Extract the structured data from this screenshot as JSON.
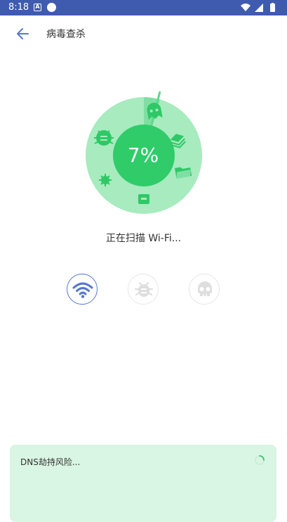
{
  "status_bar": {
    "time": "8:18",
    "icons": [
      "accessibility-icon",
      "circle-notification-icon",
      "wifi-icon",
      "signal-icon",
      "battery-icon"
    ]
  },
  "header": {
    "title": "病毒查杀",
    "back_icon": "arrow-left-icon"
  },
  "scanner": {
    "progress_text": "7%",
    "progress": 0.07,
    "status_text": "正在扫描 Wi-Fi...",
    "ring_icons": [
      "bug-icon",
      "virus-icon",
      "ghost-icon",
      "layers-icon",
      "folder-icon",
      "chip-icon"
    ]
  },
  "steps": [
    {
      "name": "wifi",
      "icon": "wifi-icon",
      "state": "active"
    },
    {
      "name": "virus",
      "icon": "bug-icon",
      "state": "pending"
    },
    {
      "name": "threat",
      "icon": "skull-icon",
      "state": "pending"
    }
  ],
  "risk_card": {
    "item_text": "DNS劫持风险..."
  },
  "colors": {
    "status_bar": "#3f5bb0",
    "accent_blue": "#5778d0",
    "green_light": "#9ee8b8",
    "green_mid": "#5fd88b",
    "green_dark": "#2fc866",
    "card_bg": "#d9f5e3"
  }
}
